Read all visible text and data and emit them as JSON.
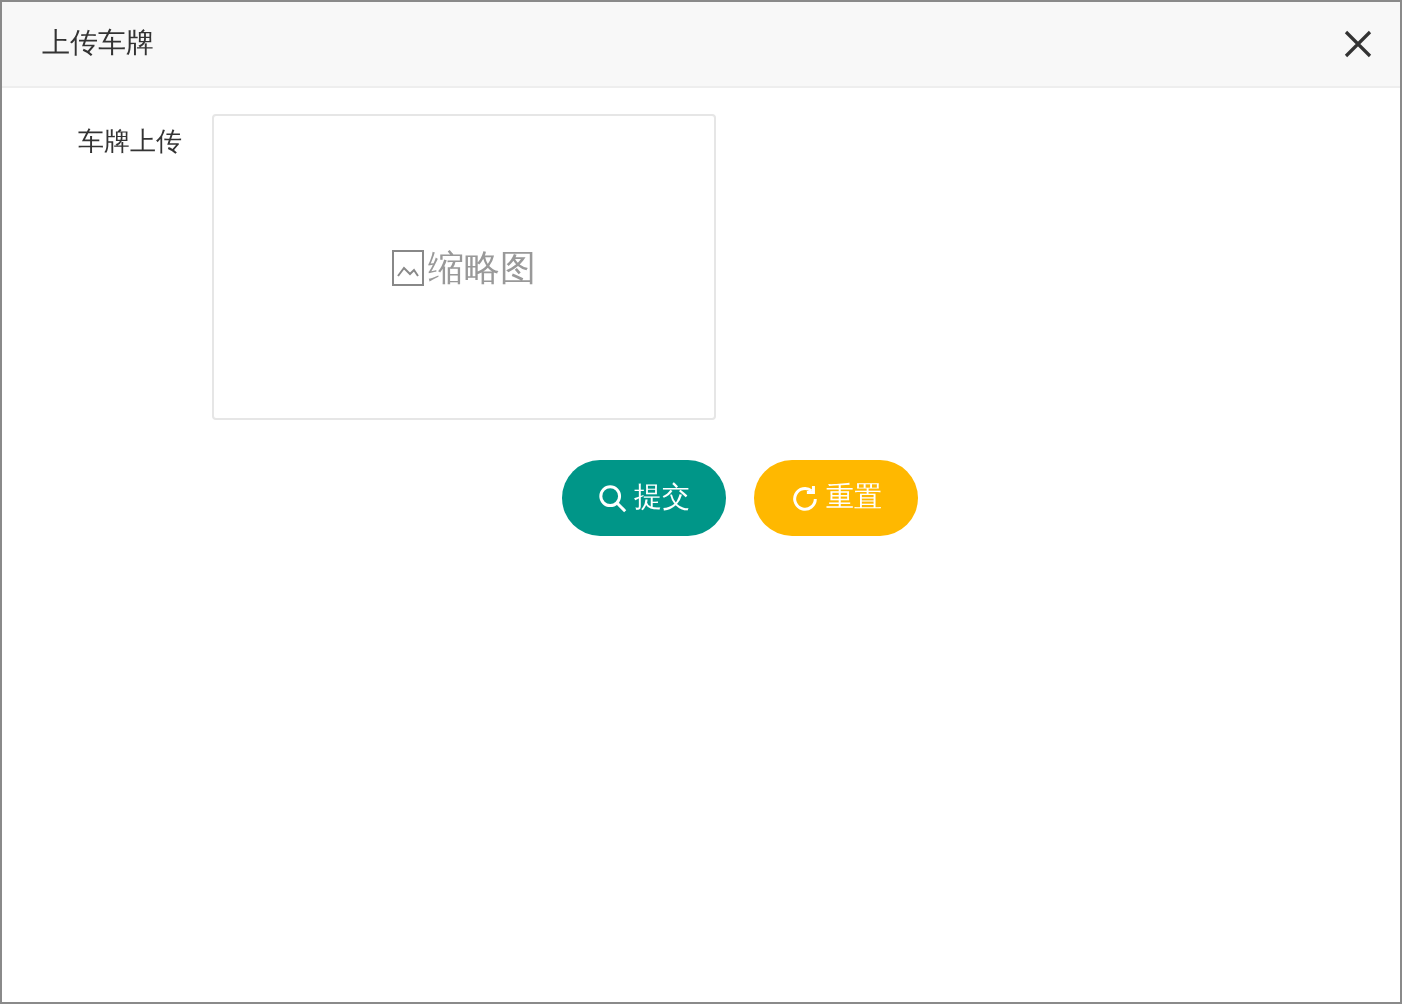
{
  "window": {
    "title": "上传车牌"
  },
  "form": {
    "label": "车牌上传",
    "thumbnail": {
      "alt": "缩略图"
    }
  },
  "buttons": [
    {
      "kind": "search",
      "label": "提交"
    },
    {
      "kind": "reset",
      "label": "重置"
    }
  ]
}
